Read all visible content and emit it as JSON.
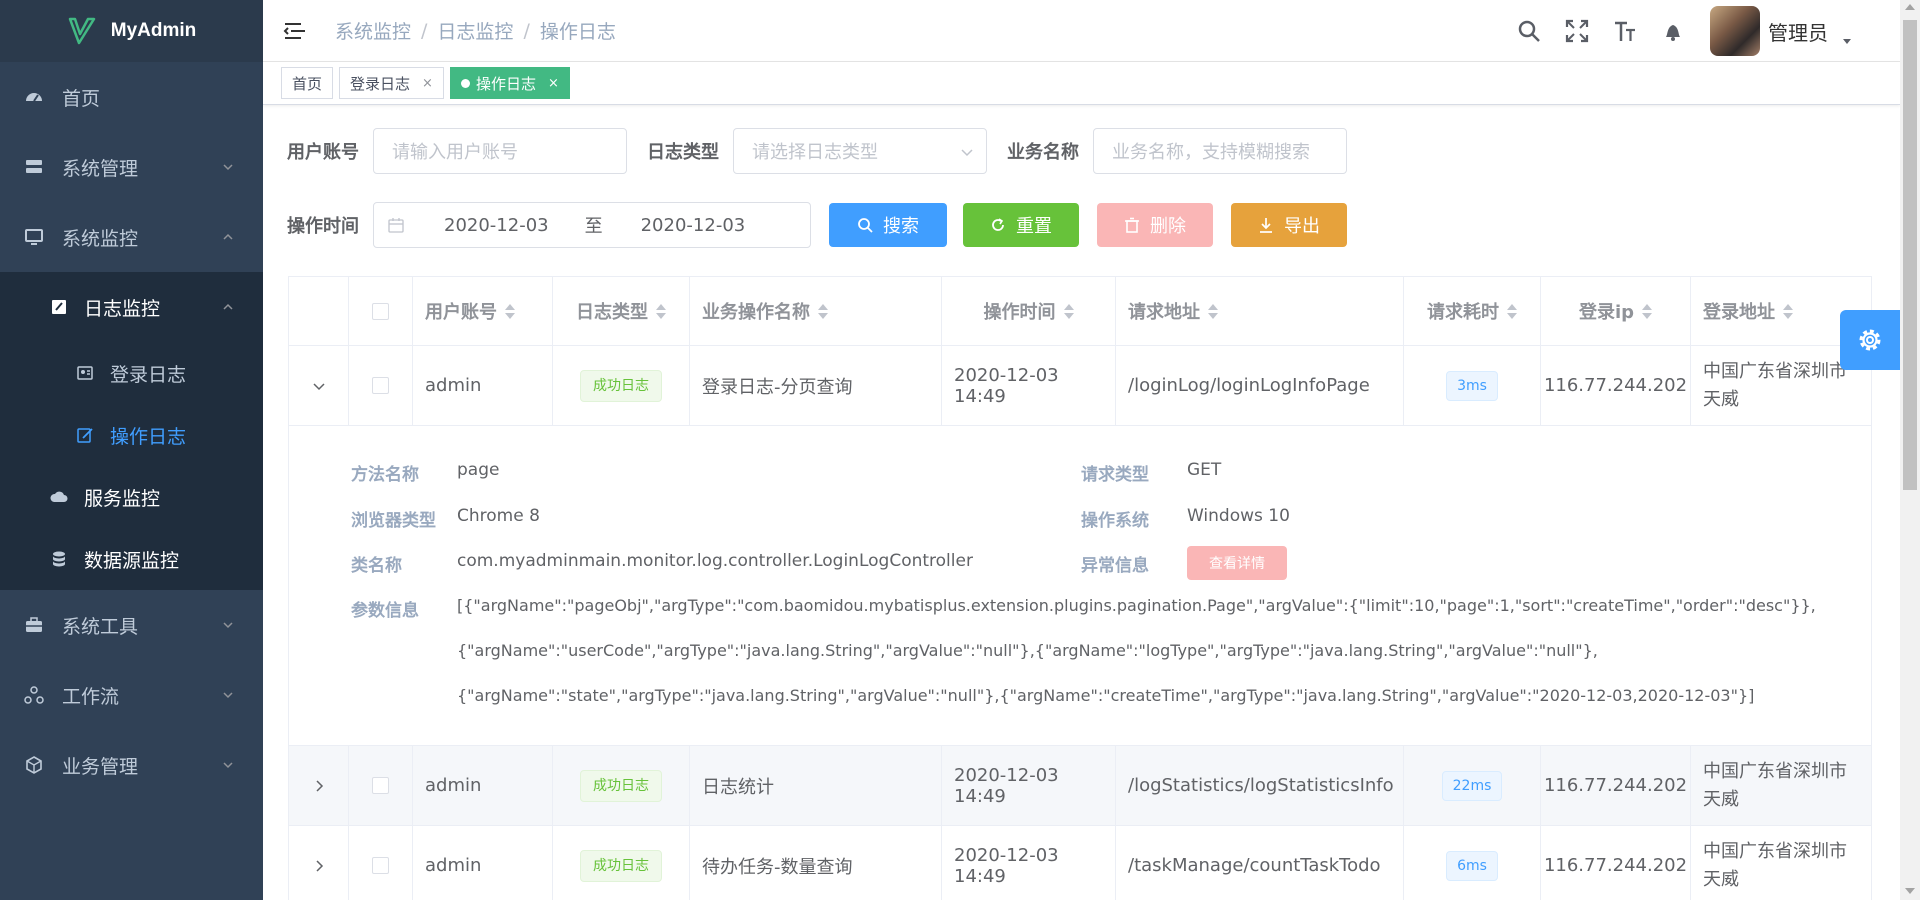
{
  "app": {
    "title": "MyAdmin"
  },
  "sidebar": {
    "items": [
      {
        "label": "首页",
        "icon": "dashboard-icon"
      },
      {
        "label": "系统管理",
        "icon": "system-icon"
      },
      {
        "label": "系统监控",
        "icon": "monitor-icon"
      },
      {
        "label": "日志监控",
        "icon": "log-icon"
      },
      {
        "label": "登录日志",
        "icon": "login-log-icon"
      },
      {
        "label": "操作日志",
        "icon": "edit-log-icon"
      },
      {
        "label": "服务监控",
        "icon": "cloud-icon"
      },
      {
        "label": "数据源监控",
        "icon": "database-icon"
      },
      {
        "label": "系统工具",
        "icon": "toolbox-icon"
      },
      {
        "label": "工作流",
        "icon": "workflow-icon"
      },
      {
        "label": "业务管理",
        "icon": "business-icon"
      }
    ]
  },
  "header": {
    "breadcrumb": [
      "系统监控",
      "日志监控",
      "操作日志"
    ],
    "user": "管理员"
  },
  "tags": [
    {
      "label": "首页"
    },
    {
      "label": "登录日志",
      "close": "×"
    },
    {
      "label": "操作日志",
      "close": "×"
    }
  ],
  "filters": {
    "user_label": "用户账号",
    "user_placeholder": "请输入用户账号",
    "type_label": "日志类型",
    "type_placeholder": "请选择日志类型",
    "biz_label": "业务名称",
    "biz_placeholder": "业务名称，支持模糊搜索",
    "time_label": "操作时间",
    "date_start": "2020-12-03",
    "date_to": "至",
    "date_end": "2020-12-03"
  },
  "buttons": {
    "search": "搜索",
    "reset": "重置",
    "delete": "删除",
    "export": "导出"
  },
  "table": {
    "headers": [
      "用户账号",
      "日志类型",
      "业务操作名称",
      "操作时间",
      "请求地址",
      "请求耗时",
      "登录ip",
      "登录地址"
    ],
    "rows": [
      {
        "user": "admin",
        "type": "成功日志",
        "name": "登录日志-分页查询",
        "time": "2020-12-03 14:49",
        "url": "/loginLog/loginLogInfoPage",
        "cost": "3ms",
        "ip": "116.77.244.202",
        "addr1": "中国广东省深圳市",
        "addr2": "天威"
      },
      {
        "user": "admin",
        "type": "成功日志",
        "name": "日志统计",
        "time": "2020-12-03 14:49",
        "url": "/logStatistics/logStatisticsInfo",
        "cost": "22ms",
        "ip": "116.77.244.202",
        "addr1": "中国广东省深圳市",
        "addr2": "天威"
      },
      {
        "user": "admin",
        "type": "成功日志",
        "name": "待办任务-数量查询",
        "time": "2020-12-03 14:49",
        "url": "/taskManage/countTaskTodo",
        "cost": "6ms",
        "ip": "116.77.244.202",
        "addr1": "中国广东省深圳市",
        "addr2": "天威"
      }
    ]
  },
  "detail": {
    "method_label": "方法名称",
    "method": "page",
    "reqtype_label": "请求类型",
    "reqtype": "GET",
    "browser_label": "浏览器类型",
    "browser": "Chrome 8",
    "os_label": "操作系统",
    "os": "Windows 10",
    "class_label": "类名称",
    "class": "com.myadminmain.monitor.log.controller.LoginLogController",
    "error_label": "异常信息",
    "error_btn": "查看详情",
    "param_label": "参数信息",
    "param_line1": "[{\"argName\":\"pageObj\",\"argType\":\"com.baomidou.mybatisplus.extension.plugins.pagination.Page\",\"argValue\":{\"limit\":10,\"page\":1,\"sort\":\"createTime\",\"order\":\"desc\"}},",
    "param_line2": "{\"argName\":\"userCode\",\"argType\":\"java.lang.String\",\"argValue\":\"null\"},{\"argName\":\"logType\",\"argType\":\"java.lang.String\",\"argValue\":\"null\"},",
    "param_line3": "{\"argName\":\"state\",\"argType\":\"java.lang.String\",\"argValue\":\"null\"},{\"argName\":\"createTime\",\"argType\":\"java.lang.String\",\"argValue\":\"2020-12-03,2020-12-03\"}]"
  },
  "colors": {
    "sidebar": "#304156",
    "primary": "#409eff",
    "success": "#67c23a",
    "warning": "#e6a23c",
    "danger_light": "#fab6b6",
    "tag_active": "#42b983"
  }
}
